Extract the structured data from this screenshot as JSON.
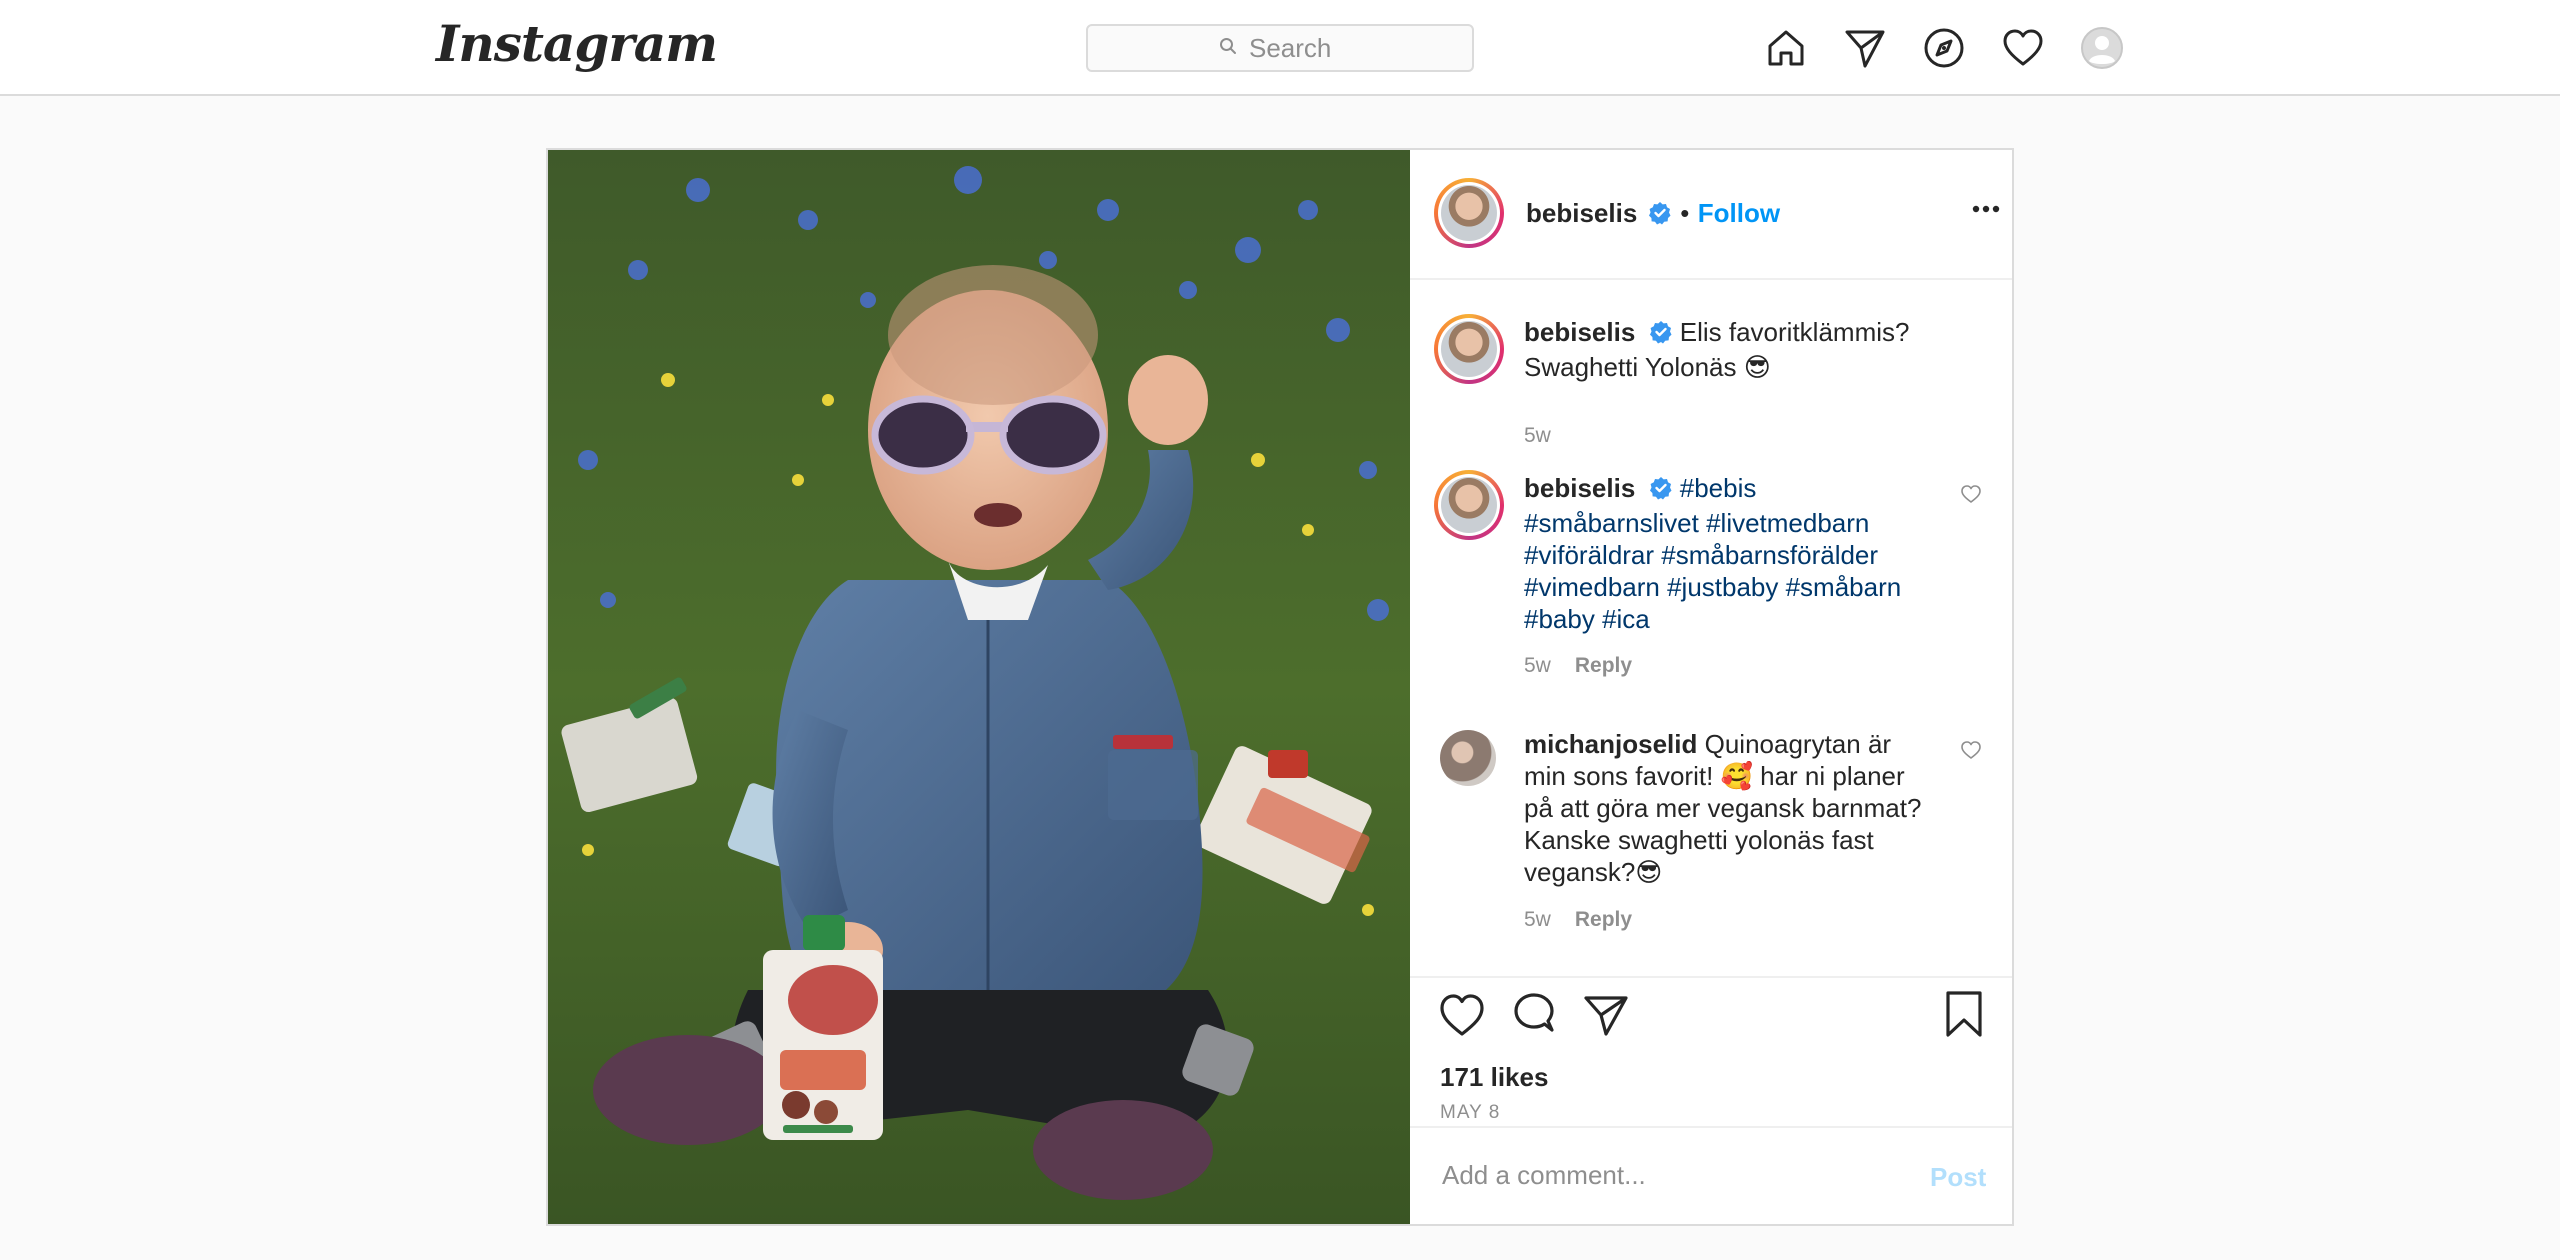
{
  "nav": {
    "logo": "Instagram",
    "search_placeholder": "Search",
    "icons": [
      "home-icon",
      "direct-icon",
      "explore-icon",
      "activity-heart-icon",
      "profile-avatar"
    ]
  },
  "post": {
    "author": "bebiselis",
    "verified": true,
    "follow_label": "Follow",
    "separator": "•",
    "photo_alt": "",
    "caption": {
      "user": "bebiselis",
      "text": "Elis favoritklämmis? Swaghetti Yolonäs 😎",
      "time": "5w"
    },
    "comments": [
      {
        "user": "bebiselis",
        "text": "#bebis #småbarnslivet #livetmedbarn #viföräldrar #småbarnsförälder #vimedbarn #justbaby #småbarn #baby #ica",
        "time": "5w",
        "reply_label": "Reply"
      },
      {
        "user": "michanjoselid",
        "text": "Quinoagrytan är min sons favorit! 🥰 har ni planer på att göra mer vegansk barnmat? Kanske swaghetti yolonäs fast vegansk?😎",
        "time": "5w",
        "reply_label": "Reply"
      }
    ],
    "likes": "171 likes",
    "date": "MAY 8",
    "add_comment_placeholder": "Add a comment...",
    "post_label": "Post"
  },
  "colors": {
    "accent": "#0095f6",
    "hashtag": "#00376b",
    "muted": "#8e8e8e",
    "post_disabled": "#b2dffc",
    "border": "#dbdbdb"
  }
}
